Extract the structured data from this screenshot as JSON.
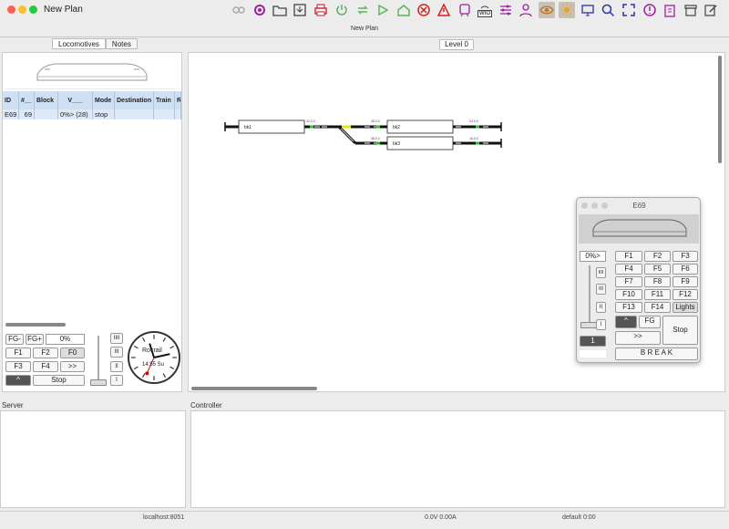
{
  "window": {
    "title": "New Plan",
    "subtitle": "New Plan",
    "traffic_colors": [
      "#ff5f57",
      "#febc2e",
      "#28c840"
    ]
  },
  "toolbar": {
    "icons": [
      "link-icon",
      "settings-icon",
      "folder-icon",
      "save-icon",
      "print-icon",
      "power-icon",
      "refresh-icon",
      "play-icon",
      "home-icon",
      "stop-icon",
      "warning-icon",
      "train-icon",
      "wio-icon",
      "sliders-icon",
      "user-icon",
      "eye-icon",
      "sun-icon",
      "monitor-icon",
      "search-icon",
      "fullscreen-icon",
      "info-icon",
      "clipboard-icon",
      "archive-icon",
      "edit-icon"
    ],
    "wio_label": "WIO"
  },
  "left_tabs": {
    "locomotives": "Locomotives",
    "notes": "Notes"
  },
  "loco_table": {
    "headers": [
      "ID",
      "#__",
      "Block",
      "V___",
      "Mode",
      "Destination",
      "Train",
      "R"
    ],
    "rows": [
      {
        "id": "E69",
        "num": "69",
        "block": "",
        "v": "0%> (28)",
        "mode": "stop",
        "destination": "",
        "train": "",
        "r": ""
      }
    ]
  },
  "left_control": {
    "fg_minus": "FG-",
    "fg_plus": "FG+",
    "speed": "0%",
    "f1": "F1",
    "f2": "F2",
    "f0": "F0",
    "f3": "F3",
    "f4": "F4",
    "forward": ">>",
    "dir": "^",
    "stop": "Stop",
    "step4": "IIII",
    "step3": "III",
    "step2": "II",
    "step1": "I"
  },
  "clock": {
    "brand": "Rocrail",
    "time": "14:55 Su"
  },
  "level": "Level 0",
  "track": {
    "blocks": [
      "bk1",
      "bk2",
      "bk3"
    ],
    "signal_labels": [
      "41,0,0",
      "46,0,0",
      "24,0,0",
      "36,0,0",
      "16,0,0"
    ]
  },
  "throttle": {
    "title": "E69",
    "speed": "0%>",
    "functions": [
      "F1",
      "F2",
      "F3",
      "F4",
      "F5",
      "F6",
      "F7",
      "F8",
      "F9",
      "F10",
      "F11",
      "F12",
      "F13",
      "F14",
      "Lights"
    ],
    "dir": "^",
    "fg": "FG",
    "stop": "Stop",
    "forward": ">>",
    "break": "B R E A K",
    "step_value": "1",
    "step4": "IIII",
    "step3": "III",
    "step2": "II",
    "step1": "I"
  },
  "panes": {
    "server": "Server",
    "controller": "Controller"
  },
  "status": {
    "host": "localhost:8051",
    "power": "0.0V 0.00A",
    "clock": "default 0:00"
  },
  "colors": {
    "table_header": "#cfe0f5",
    "table_row": "#dde9f6",
    "signal_green": "#22cc22",
    "switch_yellow": "#e8e800"
  }
}
